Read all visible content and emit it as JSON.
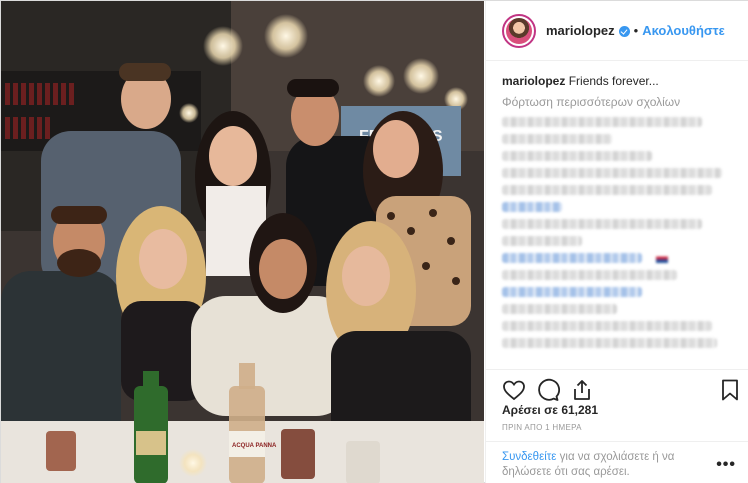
{
  "post": {
    "username": "mariolopez",
    "separator": "•",
    "follow_label": "Ακολουθήστε",
    "caption_user": "mariolopez",
    "caption_text": "Friends forever...",
    "load_more": "Φόρτωση περισσότερων σχολίων",
    "likes": "Αρέσει σε 61,281",
    "time_ago": "ΠΡΙΝ ΑΠΟ 1 ΗΜΕΡΑ",
    "login_link": "Συνδεθείτε",
    "login_rest": "για να σχολιάσετε ή να δηλώσετε ότι σας αρέσει.",
    "more_label": "•••"
  },
  "photo": {
    "bottle_label": "ACQUA PANNA",
    "awning_text": "FRANÇOIS"
  },
  "colors": {
    "link_blue": "#3897f0",
    "text": "#262626",
    "muted": "#999999",
    "border": "#efefef"
  },
  "icons": {
    "verified": "verified-badge-icon",
    "like": "heart-icon",
    "comment": "comment-bubble-icon",
    "share": "share-icon",
    "save": "bookmark-icon"
  }
}
